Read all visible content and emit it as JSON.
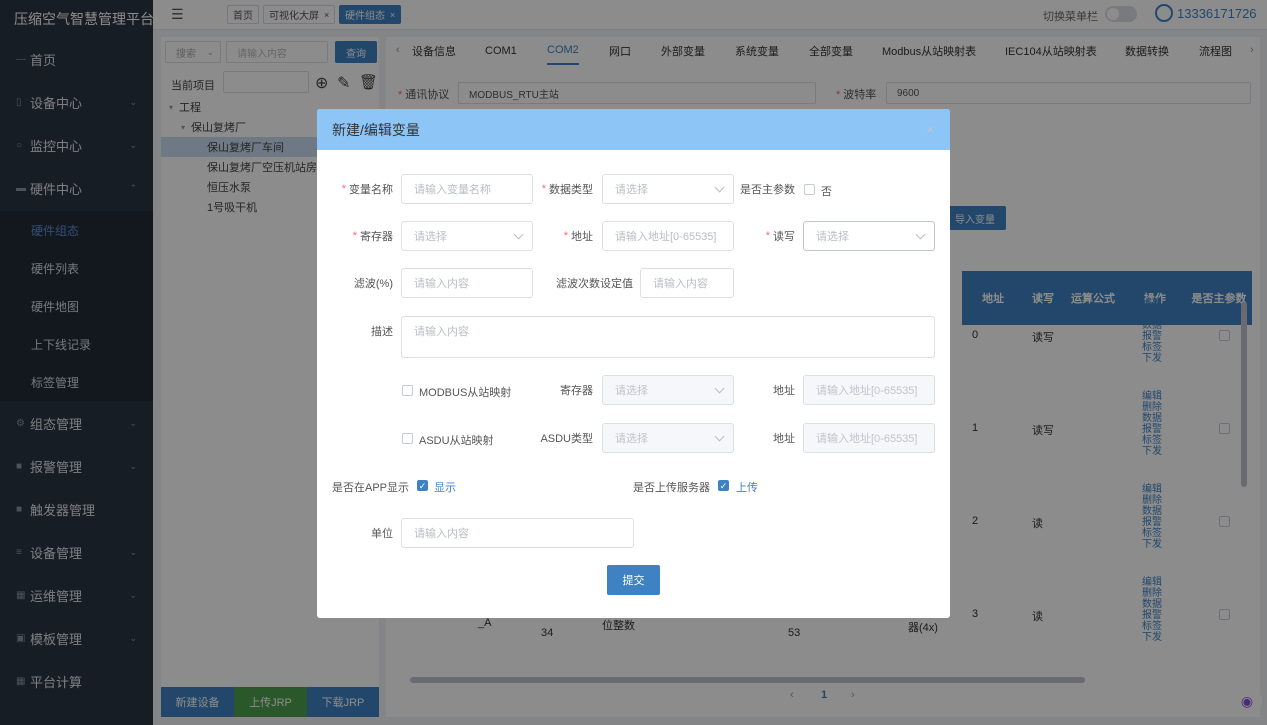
{
  "app": {
    "title": "压缩空气智慧管理平台"
  },
  "sidebar": {
    "items": [
      {
        "label": "首页"
      },
      {
        "label": "设备中心"
      },
      {
        "label": "监控中心"
      },
      {
        "label": "硬件中心"
      },
      {
        "label": "组态管理"
      },
      {
        "label": "报警管理"
      },
      {
        "label": "触发器管理"
      },
      {
        "label": "设备管理"
      },
      {
        "label": "运维管理"
      },
      {
        "label": "模板管理"
      },
      {
        "label": "平台计算"
      }
    ],
    "sub_items": [
      {
        "label": "硬件组态"
      },
      {
        "label": "硬件列表"
      },
      {
        "label": "硬件地图"
      },
      {
        "label": "上下线记录"
      },
      {
        "label": "标签管理"
      }
    ]
  },
  "topbar": {
    "tabs": [
      {
        "label": "首页"
      },
      {
        "label": "可视化大屏"
      },
      {
        "label": "硬件组态"
      }
    ],
    "toggle_label": "切换菜单栏",
    "user": "13336171726",
    "close_glyph": "×"
  },
  "tree": {
    "search_select": "搜索",
    "search_placeholder": "请输入内容",
    "search_button": "查询",
    "current_label": "当前项目",
    "nodes": [
      {
        "label": "工程"
      },
      {
        "label": "保山复烤厂"
      },
      {
        "label": "保山复烤厂车间"
      },
      {
        "label": "保山复烤厂空压机站房"
      },
      {
        "label": "恒压水泵"
      },
      {
        "label": "1号吸干机"
      }
    ],
    "bottom_buttons": [
      {
        "label": "新建设备"
      },
      {
        "label": "上传JRP"
      },
      {
        "label": "下载JRP"
      }
    ]
  },
  "content": {
    "tabs": [
      {
        "label": "设备信息"
      },
      {
        "label": "COM1"
      },
      {
        "label": "COM2"
      },
      {
        "label": "网口"
      },
      {
        "label": "外部变量"
      },
      {
        "label": "系统变量"
      },
      {
        "label": "全部变量"
      },
      {
        "label": "Modbus从站映射表"
      },
      {
        "label": "IEC104从站映射表"
      },
      {
        "label": "数据转换"
      },
      {
        "label": "流程图"
      }
    ],
    "protocol_label": "通讯协议",
    "protocol_value": "MODBUS_RTU主站",
    "baud_label": "波特率",
    "baud_value": "9600",
    "import_button": "导入变量",
    "table_headers": [
      {
        "label": "地址"
      },
      {
        "label": "读写"
      },
      {
        "label": "运算公式"
      },
      {
        "label": "操作"
      },
      {
        "label": "是否主参数"
      }
    ],
    "rows": [
      {
        "addr": "0",
        "rw": "读写"
      },
      {
        "addr": "1",
        "rw": "读写"
      },
      {
        "addr": "2",
        "rw": "读"
      },
      {
        "addr": "3",
        "rw": "读"
      }
    ],
    "ops": [
      "编辑",
      "删除",
      "数据",
      "报警",
      "标签",
      "下发"
    ],
    "partial_cells": {
      "a": "_A",
      "b": "34",
      "c": "位整数",
      "d": "53",
      "e": "器(4x)"
    },
    "pager": "1"
  },
  "modal": {
    "title": "新建/编辑变量",
    "close_glyph": "×",
    "var_name_label": "变量名称",
    "var_name_placeholder": "请输入变量名称",
    "data_type_label": "数据类型",
    "select_placeholder": "请选择",
    "main_param_label": "是否主参数",
    "main_param_value": "否",
    "register_label": "寄存器",
    "address_label": "地址",
    "address_placeholder": "请输入地址[0-65535]",
    "rw_label": "读写",
    "filter_label": "滤波(%)",
    "content_placeholder": "请输入内容",
    "filter_count_label": "滤波次数设定值",
    "desc_label": "描述",
    "modbus_map_label": "MODBUS从站映射",
    "asdu_map_label": "ASDU从站映射",
    "asdu_type_label": "ASDU类型",
    "app_show_label": "是否在APP显示",
    "app_show_value": "显示",
    "upload_label": "是否上传服务器",
    "upload_value": "上传",
    "unit_label": "单位",
    "submit": "提交"
  },
  "colors": {
    "accent": "#3e82c4",
    "sidebar": "#2b3543",
    "modal_header": "#8ec5f7",
    "upload_btn": "#4da04d"
  }
}
